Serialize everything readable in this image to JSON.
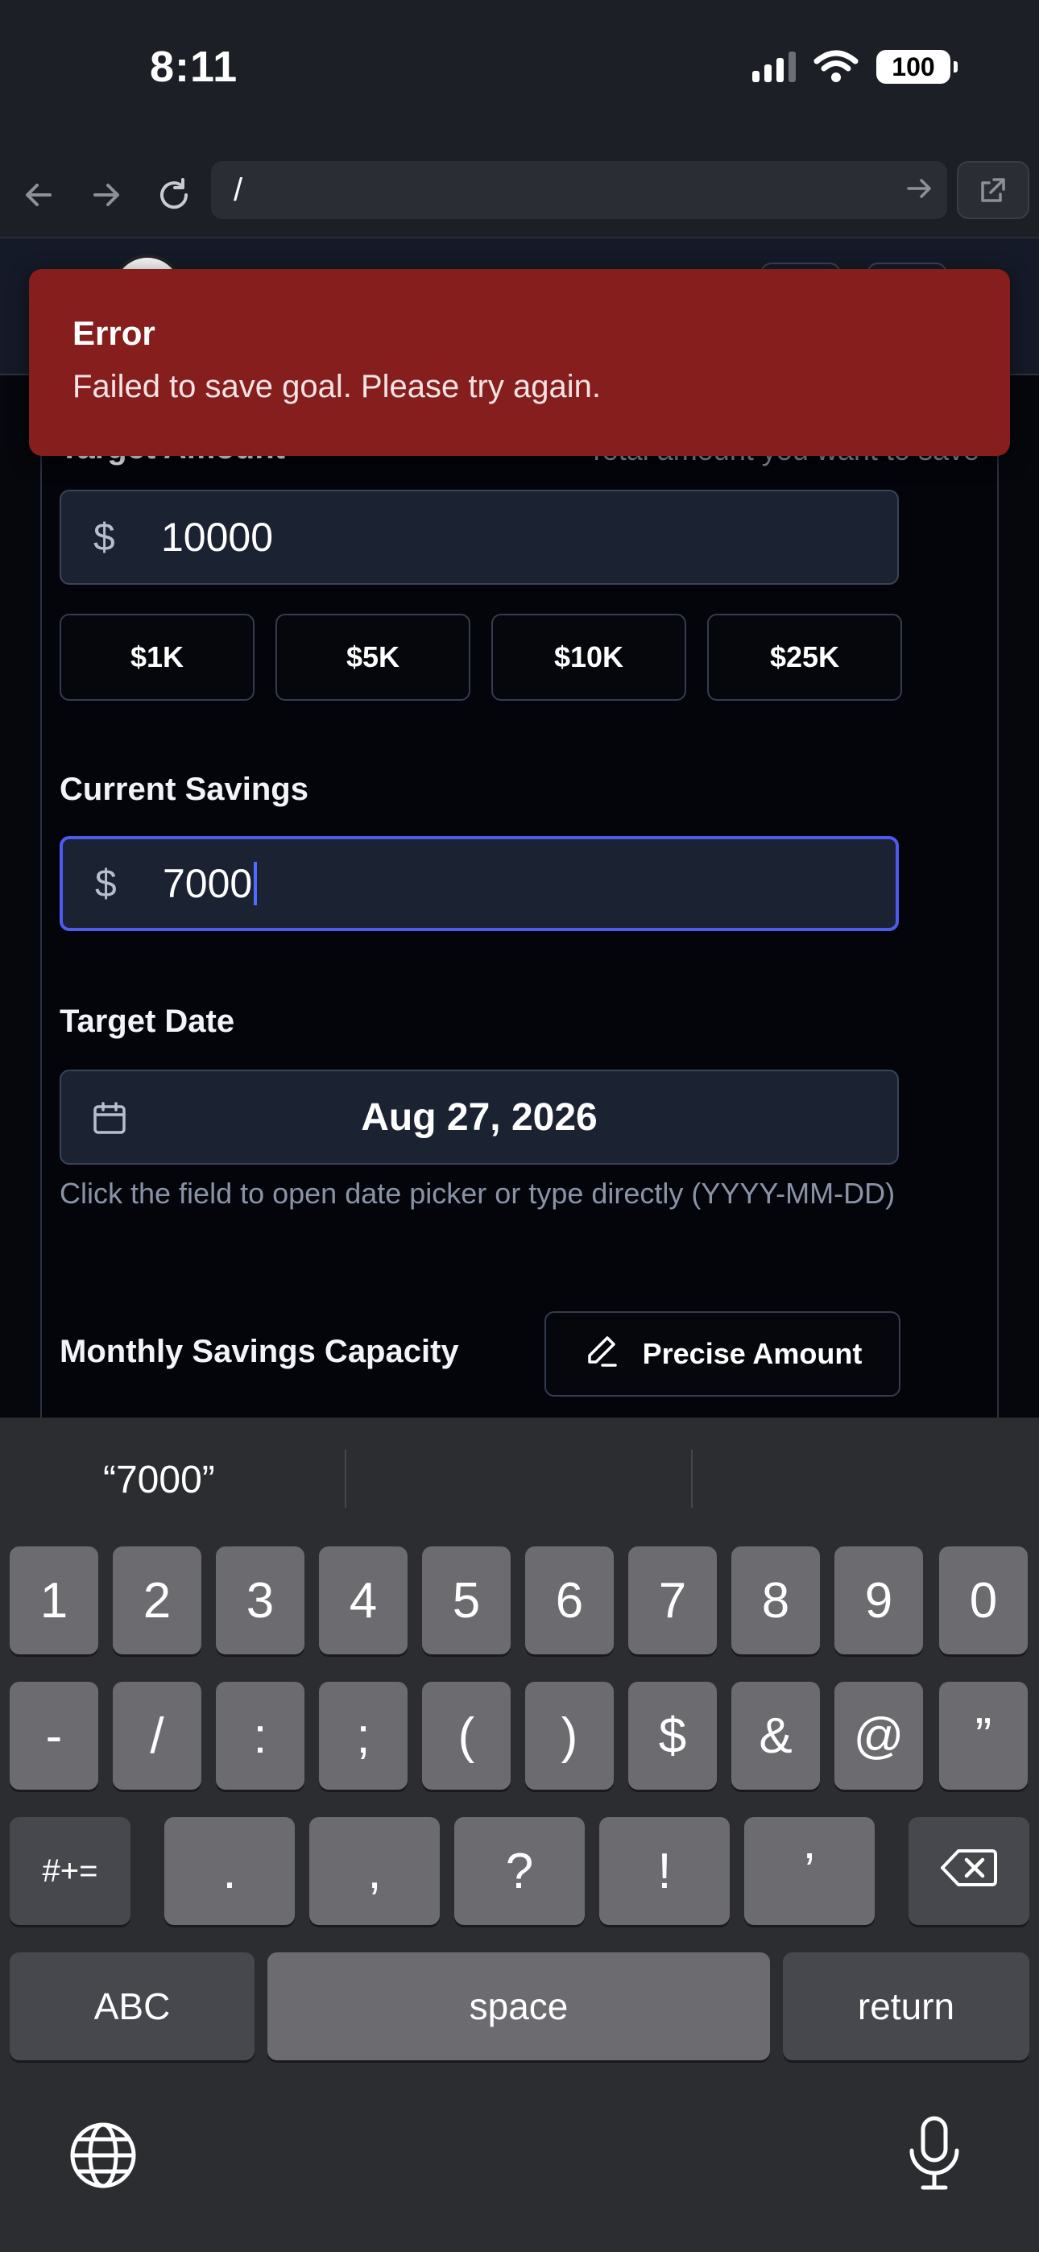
{
  "status_bar": {
    "time": "8:11",
    "battery": "100"
  },
  "browser": {
    "url": "/"
  },
  "toast": {
    "title": "Error",
    "message": "Failed to save goal. Please try again."
  },
  "form": {
    "target_amount": {
      "label": "Target Amount",
      "hint": "Total amount you want to save",
      "currency": "$",
      "value": "10000"
    },
    "presets": [
      "$1K",
      "$5K",
      "$10K",
      "$25K"
    ],
    "current_savings": {
      "label": "Current Savings",
      "currency": "$",
      "value": "7000"
    },
    "target_date": {
      "label": "Target Date",
      "value": "Aug 27, 2026",
      "help": "Click the field to open date picker or type directly (YYYY-MM-DD)"
    },
    "monthly_capacity": {
      "label": "Monthly Savings Capacity",
      "precise_button": "Precise Amount"
    }
  },
  "keyboard": {
    "suggestion": "“7000”",
    "row1": [
      "1",
      "2",
      "3",
      "4",
      "5",
      "6",
      "7",
      "8",
      "9",
      "0"
    ],
    "row2": [
      "-",
      "/",
      ":",
      ";",
      "(",
      ")",
      "$",
      "&",
      "@",
      "”"
    ],
    "row3": {
      "toggle": "#+=",
      "keys": [
        ".",
        ",",
        "?",
        "!",
        "’"
      ]
    },
    "row4": {
      "abc": "ABC",
      "space": "space",
      "return": "return"
    }
  }
}
